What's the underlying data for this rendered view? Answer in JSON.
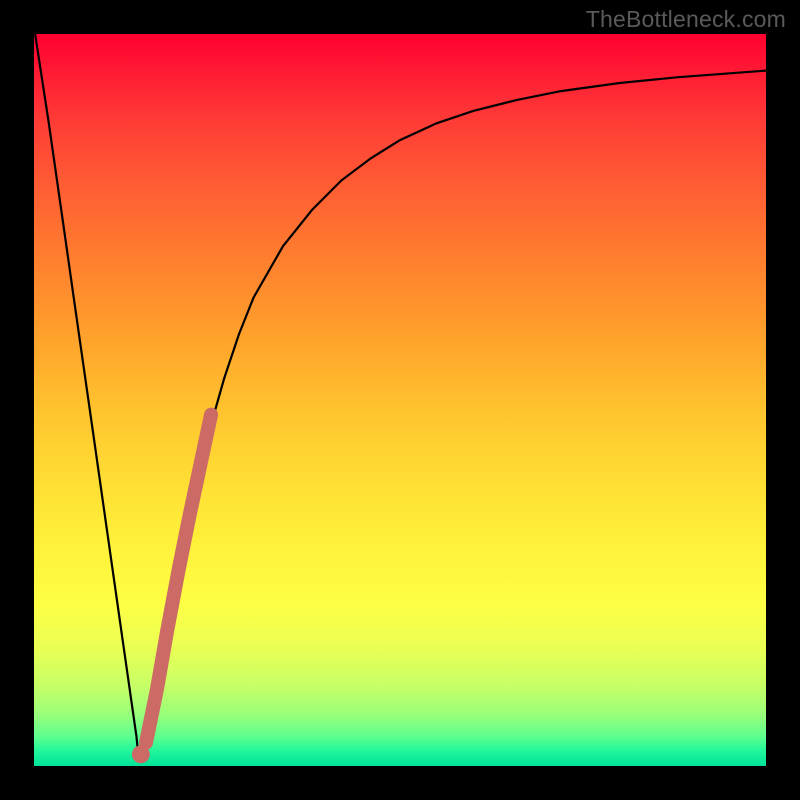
{
  "watermark": "TheBottleneck.com",
  "chart_data": {
    "type": "line",
    "title": "",
    "xlabel": "",
    "ylabel": "",
    "xlim": [
      0,
      100
    ],
    "ylim": [
      0,
      100
    ],
    "grid": false,
    "series": [
      {
        "name": "bottleneck-curve",
        "color": "#000000",
        "stroke_width": 2.2,
        "x": [
          0,
          2,
          4,
          6,
          8,
          10,
          12,
          14,
          14.2,
          14.5,
          15,
          16,
          18,
          20,
          22,
          24,
          26,
          28,
          30,
          34,
          38,
          42,
          46,
          50,
          55,
          60,
          66,
          72,
          80,
          88,
          96,
          100
        ],
        "y": [
          101,
          88,
          74,
          60,
          46,
          32,
          18,
          4,
          2,
          1,
          2,
          6,
          17,
          28,
          38,
          46,
          53,
          59,
          64,
          71,
          76,
          80,
          83,
          85.5,
          87.8,
          89.5,
          91,
          92.2,
          93.3,
          94.1,
          94.7,
          95
        ]
      },
      {
        "name": "highlight-segment",
        "color": "#cc6a66",
        "stroke_width": 14,
        "linecap": "round",
        "x": [
          15.3,
          16.8,
          18.2,
          19.8,
          21.2,
          22.8,
          24.2
        ],
        "y": [
          3.2,
          10.5,
          18.5,
          27,
          34,
          41.5,
          48
        ]
      },
      {
        "name": "highlight-dot",
        "color": "#cc6a66",
        "type": "marker",
        "radius": 9,
        "x": [
          14.6
        ],
        "y": [
          1.6
        ]
      }
    ],
    "background": {
      "type": "vertical-gradient",
      "stops": [
        {
          "pos": 0.0,
          "color": "#ff0030"
        },
        {
          "pos": 0.5,
          "color": "#ffbf2d"
        },
        {
          "pos": 0.8,
          "color": "#fdff45"
        },
        {
          "pos": 1.0,
          "color": "#00e39a"
        }
      ]
    }
  }
}
